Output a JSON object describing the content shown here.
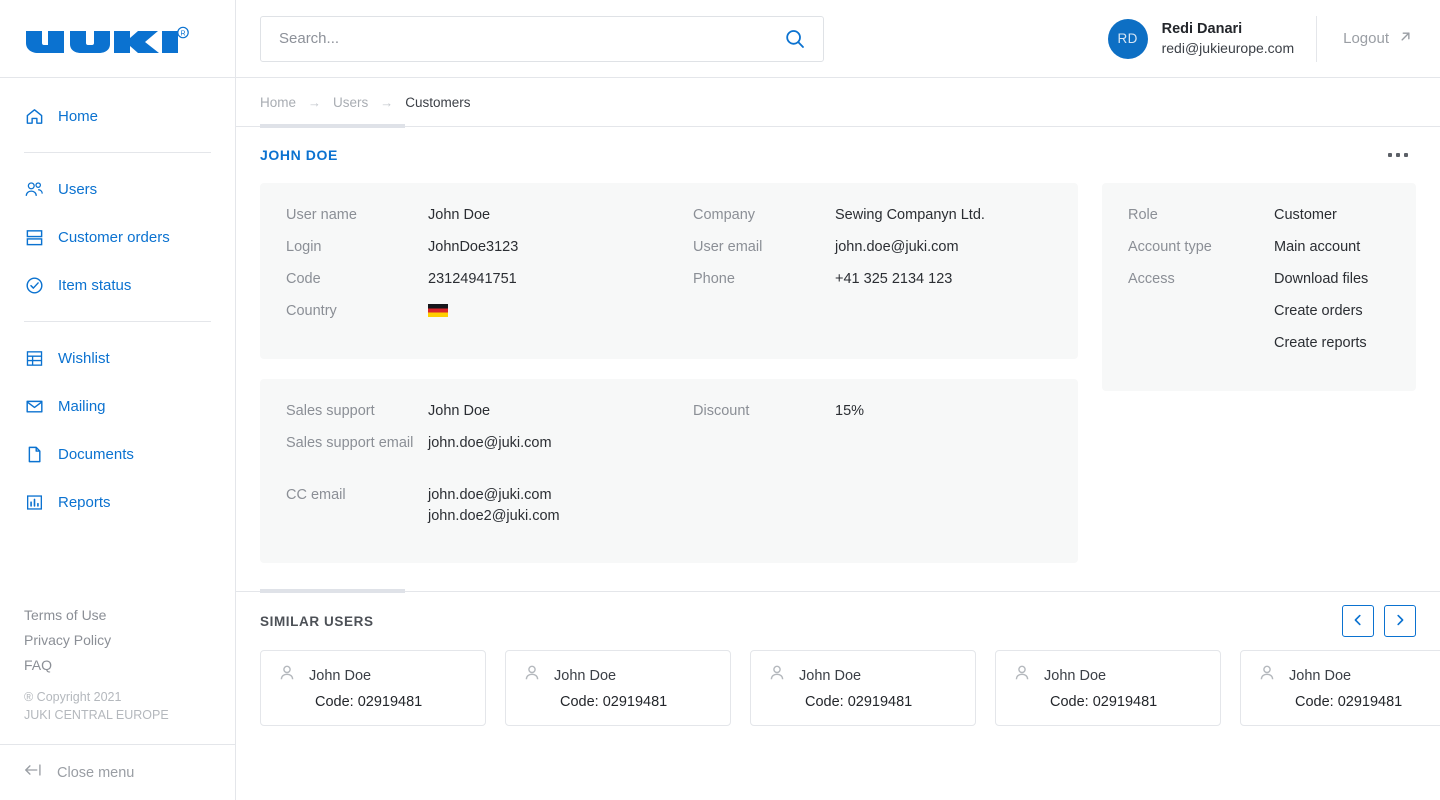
{
  "brand": {
    "logo_text": "JUKI",
    "logo_registered": "®",
    "accent_color": "#0b72d0"
  },
  "search": {
    "placeholder": "Search...",
    "value": "",
    "icon": "search-icon"
  },
  "profile": {
    "initials": "RD",
    "name": "Redi Danari",
    "email": "redi@jukieurope.com",
    "logout_label": "Logout",
    "logout_icon": "external-link-arrow-icon"
  },
  "sidebar": {
    "primary_items": [
      {
        "label": "Home",
        "icon": "home-icon"
      }
    ],
    "group_one": [
      {
        "label": "Users",
        "icon": "users-icon"
      },
      {
        "label": "Customer orders",
        "icon": "orders-icon"
      },
      {
        "label": "Item status",
        "icon": "check-circle-icon"
      }
    ],
    "group_two": [
      {
        "label": "Wishlist",
        "icon": "table-icon"
      },
      {
        "label": "Mailing",
        "icon": "envelope-icon"
      },
      {
        "label": "Documents",
        "icon": "document-icon"
      },
      {
        "label": "Reports",
        "icon": "bar-chart-icon"
      }
    ],
    "legal_links": [
      {
        "label": "Terms of Use"
      },
      {
        "label": "Privacy Policy"
      },
      {
        "label": "FAQ"
      }
    ],
    "copyright_line_1": "® Copyright 2021",
    "copyright_line_2": "JUKI CENTRAL EUROPE",
    "close_menu_label": "Close menu",
    "close_menu_icon": "arrow-left-bar-icon"
  },
  "breadcrumb": {
    "items": [
      {
        "label": "Home",
        "active": false
      },
      {
        "label": "Users",
        "active": false
      },
      {
        "label": "Customers",
        "active": true
      }
    ],
    "separator": "→"
  },
  "detail": {
    "title": "JOHN DOE",
    "menu_icon": "more-options-icon",
    "card_personal": {
      "column_left": [
        {
          "key": "User name",
          "value": "John Doe"
        },
        {
          "key": "Login",
          "value": "JohnDoe3123"
        },
        {
          "key": "Code",
          "value": "23124941751"
        },
        {
          "key": "Country",
          "value": "",
          "flag": "germany-flag"
        }
      ],
      "column_right": [
        {
          "key": "Company",
          "value": "Sewing Companyn Ltd."
        },
        {
          "key": "User email",
          "value": "john.doe@juki.com"
        },
        {
          "key": "Phone",
          "value": "+41 325 2134 123"
        }
      ]
    },
    "card_support": {
      "column_left": [
        {
          "key": "Sales support",
          "value": "John Doe"
        },
        {
          "key": "Sales support email",
          "value": "john.doe@juki.com"
        },
        {
          "key": "CC email",
          "value": "john.doe@juki.com\njohn.doe2@juki.com"
        }
      ],
      "column_right": [
        {
          "key": "Discount",
          "value": "15%"
        }
      ]
    },
    "card_role": {
      "rows": [
        {
          "key": "Role",
          "value": "Customer"
        },
        {
          "key": "Account type",
          "value": "Main account"
        },
        {
          "key": "Access",
          "value": "Download files"
        }
      ],
      "access_extra": [
        "Create orders",
        "Create reports"
      ]
    }
  },
  "similar_users": {
    "title": "SIMILAR USERS",
    "prev_icon": "chevron-left-icon",
    "next_icon": "chevron-right-icon",
    "code_label": "Code:",
    "cards": [
      {
        "name": "John Doe",
        "code": "02919481",
        "icon": "person-icon"
      },
      {
        "name": "John Doe",
        "code": "02919481",
        "icon": "person-icon"
      },
      {
        "name": "John Doe",
        "code": "02919481",
        "icon": "person-icon"
      },
      {
        "name": "John Doe",
        "code": "02919481",
        "icon": "person-icon"
      },
      {
        "name": "John Doe",
        "code": "02919481",
        "icon": "person-icon"
      }
    ]
  }
}
